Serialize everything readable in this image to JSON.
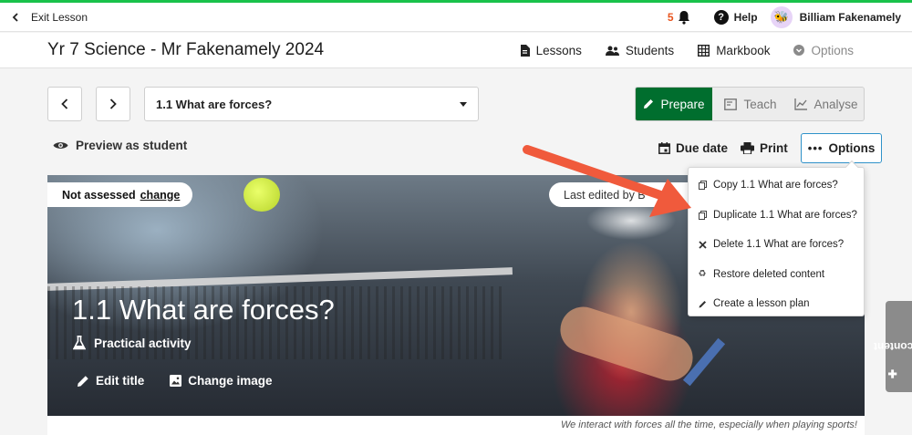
{
  "topbar": {
    "exit_label": "Exit Lesson",
    "notification_count": "5",
    "help_label": "Help",
    "user_name": "Billiam Fakenamely"
  },
  "header": {
    "course_title": "Yr 7 Science - Mr Fakenamely 2024",
    "nav": {
      "lessons": "Lessons",
      "students": "Students",
      "markbook": "Markbook",
      "options": "Options"
    }
  },
  "lesson": {
    "selected": "1.1 What are forces?"
  },
  "modes": {
    "prepare": "Prepare",
    "teach": "Teach",
    "analyse": "Analyse"
  },
  "toolbar": {
    "preview_label": "Preview as student",
    "due_date_label": "Due date",
    "print_label": "Print",
    "options_label": "Options"
  },
  "hero": {
    "assessment_status": "Not assessed",
    "change_label": "change",
    "last_edited": "Last edited by B",
    "title": "1.1 What are forces?",
    "activity_type": "Practical activity",
    "edit_title_label": "Edit title",
    "change_image_label": "Change image",
    "caption": "We interact with forces all the time, especially when playing sports!"
  },
  "options_menu": {
    "items": [
      {
        "label": "Copy 1.1 What are forces?",
        "icon": "copy-icon"
      },
      {
        "label": "Duplicate 1.1 What are forces?",
        "icon": "duplicate-icon"
      },
      {
        "label": "Delete 1.1 What are forces?",
        "icon": "close-icon"
      },
      {
        "label": "Restore deleted content",
        "icon": "recycle-icon"
      },
      {
        "label": "Create a lesson plan",
        "icon": "pencil-icon"
      }
    ]
  },
  "sidebar_tab": {
    "add_content_label": "Add content"
  },
  "colors": {
    "prepare_active": "#006e2e",
    "top_strip": "#19c24a",
    "notification": "#e8541d",
    "options_border": "#2f92c9",
    "arrow": "#f05a3c"
  }
}
